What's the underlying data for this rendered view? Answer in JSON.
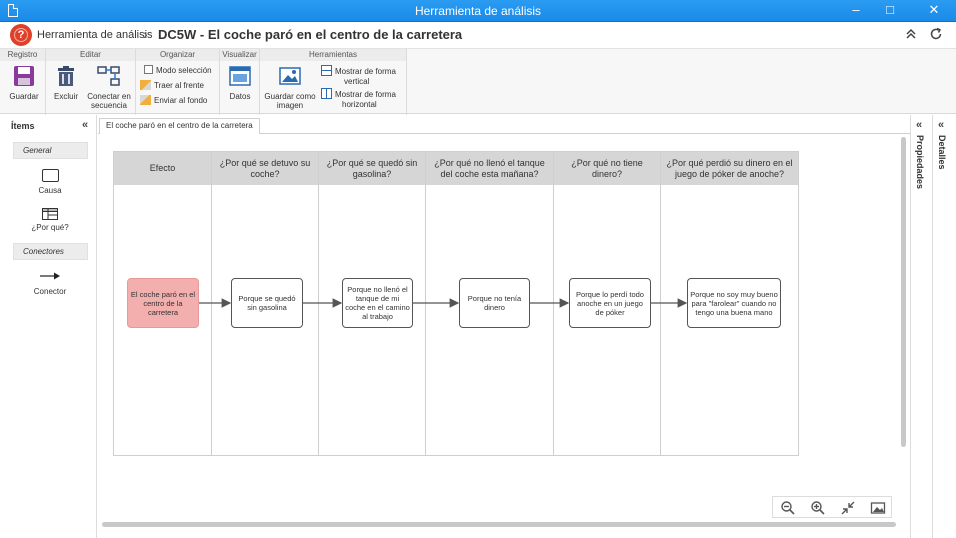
{
  "window": {
    "title": "Herramienta de análisis"
  },
  "header": {
    "breadcrumb": "Herramienta de análisis",
    "separator": "›",
    "title": "DC5W - El coche paró en el centro de la carretera"
  },
  "ribbon": {
    "groups": {
      "registro": "Registro",
      "editar": "Editar",
      "organizar": "Organizar",
      "visualizar": "Visualizar",
      "herramientas": "Herramientas"
    },
    "buttons": {
      "guardar": "Guardar",
      "excluir": "Excluir",
      "conectar_1": "Conectar en",
      "conectar_2": "secuencia",
      "modo_seleccion": "Modo selección",
      "traer_frente": "Traer al frente",
      "enviar_fondo": "Enviar al fondo",
      "datos": "Datos",
      "guardar_imagen_1": "Guardar como",
      "guardar_imagen_2": "imagen",
      "vertical_1": "Mostrar de forma",
      "vertical_2": "vertical",
      "horizontal_1": "Mostrar de forma",
      "horizontal_2": "horizontal"
    }
  },
  "items_panel": {
    "title": "Ítems",
    "sections": {
      "general": "General",
      "conectores": "Conectores"
    },
    "items": {
      "causa": "Causa",
      "por_que": "¿Por qué?",
      "conector": "Conector"
    }
  },
  "tab": {
    "label": "El coche paró en el centro de la carretera"
  },
  "diagram": {
    "columns": [
      "Efecto",
      "¿Por qué se detuvo su coche?",
      "¿Por qué se quedó sin gasolina?",
      "¿Por qué no llenó el tanque del coche esta mañana?",
      "¿Por qué no tiene dinero?",
      "¿Por qué perdió su dinero en el juego de póker de anoche?"
    ],
    "nodes": [
      "El coche paró en el centro de la carretera",
      "Porque se quedó sin gasolina",
      "Porque no llenó el tanque de mi coche en el camino al trabajo",
      "Porque no tenía dinero",
      "Porque lo perdí todo anoche en un juego de póker",
      "Porque no soy muy bueno para \"farolear\" cuando no tengo una buena mano"
    ]
  },
  "right_panels": {
    "propiedades": "Propiedades",
    "detalles": "Detalles"
  },
  "colors": {
    "titlebar": "#2b9cf2",
    "effect_node": "#f3aeae",
    "column_header": "#d6d6d6",
    "logo": "#e0402a"
  },
  "icons": [
    "document-icon",
    "logo-icon",
    "collapse-up-icon",
    "refresh-icon",
    "save-icon",
    "trash-icon",
    "connect-sequence-icon",
    "checkbox-icon",
    "bring-front-icon",
    "send-back-icon",
    "data-window-icon",
    "save-image-icon",
    "vertical-layout-icon",
    "horizontal-layout-icon",
    "double-chevron-left-icon",
    "cause-box-icon",
    "why-table-icon",
    "arrow-right-icon",
    "zoom-out-icon",
    "zoom-in-icon",
    "fit-icon",
    "image-icon"
  ]
}
